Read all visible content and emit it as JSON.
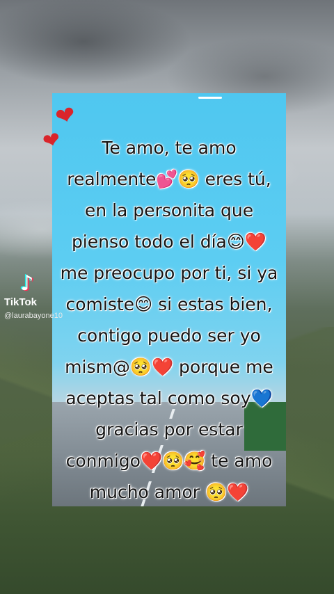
{
  "message_lines": [
    "Te amo, te amo",
    "realmente💕🥺 eres tú,",
    "en la personita que",
    "pienso todo el día😊❤️",
    "me preocupo por ti, si ya",
    "comiste😊 si estas bien,",
    "contigo puedo ser yo",
    "mism@🥺❤️ porque me",
    "aceptas tal como soy💙",
    "gracias por estar",
    "conmigo❤️🥺🥰 te amo",
    "mucho amor 🥺❤️"
  ],
  "watermark": {
    "brand": "TikTok",
    "username": "@laurabayone10",
    "logo_icon": "tiktok-note-icon"
  },
  "decor": {
    "hearts": [
      "❤",
      "❤"
    ],
    "heart_color": "#d9252b"
  }
}
